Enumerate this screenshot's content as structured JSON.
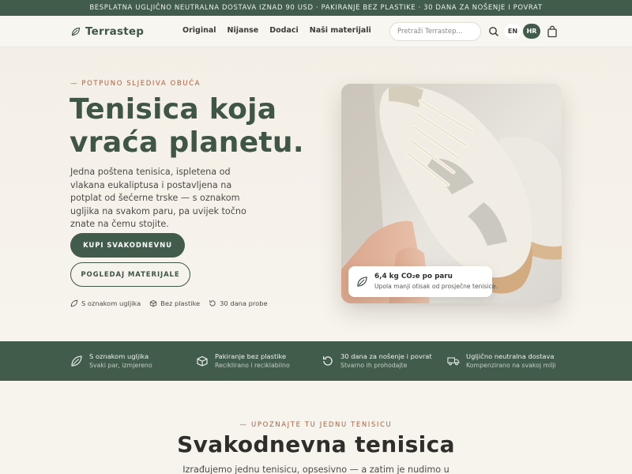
{
  "announcement": "BESPLATNA UGLJIČNO NEUTRALNA DOSTAVA IZNAD 90 USD · PAKIRANJE BEZ PLASTIKE · 30 DANA ZA NOŠENJE I POVRAT",
  "header": {
    "logo": "Terrastep",
    "nav": [
      "Original",
      "Nijanse",
      "Dodaci",
      "Naši materijali"
    ],
    "search_placeholder": "Pretraži Terrastep...",
    "languages": [
      "EN",
      "HR"
    ],
    "active_language": "HR"
  },
  "hero": {
    "eyebrow": "— POTPUNO SLJEDIVA OBUĆA",
    "title_line1": "Tenisica koja",
    "title_line2": "vraća planetu.",
    "lead": "Jedna poštena tenisica, ispletena od vlakana eukaliptusa i postavljena na potplat od šećerne trske — s oznakom ugljika na svakom paru, pa uvijek točno znate na čemu stojite.",
    "primary_button": "KUPI SVAKODNEVNU",
    "secondary_button": "POGLEDAJ MATERIJALE",
    "perks": [
      "S oznakom ugljika",
      "Bez plastike",
      "30 dana probe"
    ],
    "badge": {
      "title": "6,4 kg CO₂e po paru",
      "subtitle": "Upola manji otisak od prosječne tenisice."
    }
  },
  "features": [
    {
      "title": "S oznakom ugljika",
      "subtitle": "Svaki par, izmjereno",
      "icon": "leaf-icon"
    },
    {
      "title": "Pakiranje bez plastike",
      "subtitle": "Reciklirano i reciklabilno",
      "icon": "box-icon"
    },
    {
      "title": "30 dana za nošenje i povrat",
      "subtitle": "Stvarno ih prohodajte",
      "icon": "return-icon"
    },
    {
      "title": "Ugljično neutralna dostava",
      "subtitle": "Kompenzirano na svakoj milji",
      "icon": "truck-icon"
    }
  ],
  "intro": {
    "eyebrow": "— UPOZNAJTE TU JEDNU TENISICU",
    "title": "Svakodnevna tenisica",
    "text": "Izrađujemo jednu tenisicu, opsesivno — a zatim je nudimo u"
  },
  "colors": {
    "brand_green": "#415c4b",
    "accent_terracotta": "#a9603e",
    "cream": "#f5f1ea"
  }
}
